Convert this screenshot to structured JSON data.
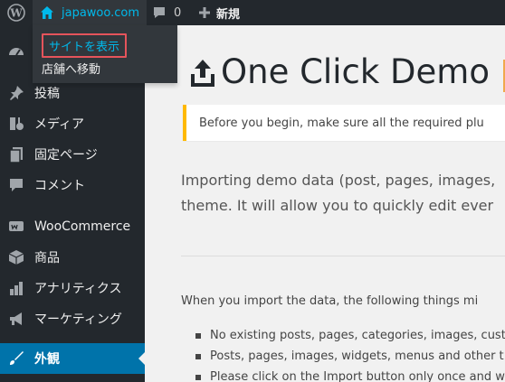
{
  "adminbar": {
    "site_name": "japawoo.com",
    "comments_count": "0",
    "new_label": "新規",
    "dropdown": {
      "view_site": "サイトを表示",
      "visit_store": "店舗へ移動"
    }
  },
  "sidebar": {
    "items": [
      {
        "label": "",
        "icon": "dashboard-icon"
      },
      {
        "label": "投稿",
        "icon": "pin-icon"
      },
      {
        "label": "メディア",
        "icon": "media-icon"
      },
      {
        "label": "固定ページ",
        "icon": "page-icon"
      },
      {
        "label": "コメント",
        "icon": "comment-icon"
      },
      {
        "label": "WooCommerce",
        "icon": "woocommerce-icon"
      },
      {
        "label": "商品",
        "icon": "box-icon"
      },
      {
        "label": "アナリティクス",
        "icon": "bar-chart-icon"
      },
      {
        "label": "マーケティング",
        "icon": "megaphone-icon"
      },
      {
        "label": "外観",
        "icon": "paintbrush-icon",
        "active": true
      }
    ]
  },
  "main": {
    "title": "One Click Demo",
    "notice": "Before you begin, make sure all the required plu",
    "intro_line1": "Importing demo data (post, pages, images,",
    "intro_line2": "theme. It will allow you to quickly edit ever",
    "import_heading": "When you import the data, the following things mi",
    "bullets": [
      "No existing posts, pages, categories, images, cust",
      "Posts, pages, images, widgets, menus and other t",
      "Please click on the Import button only once and w"
    ]
  },
  "colors": {
    "adminbar_bg": "#23282d",
    "accent_blue": "#0073aa",
    "link_blue": "#00b9eb",
    "notice_border": "#ffb900",
    "highlight_border": "#e5545b"
  }
}
